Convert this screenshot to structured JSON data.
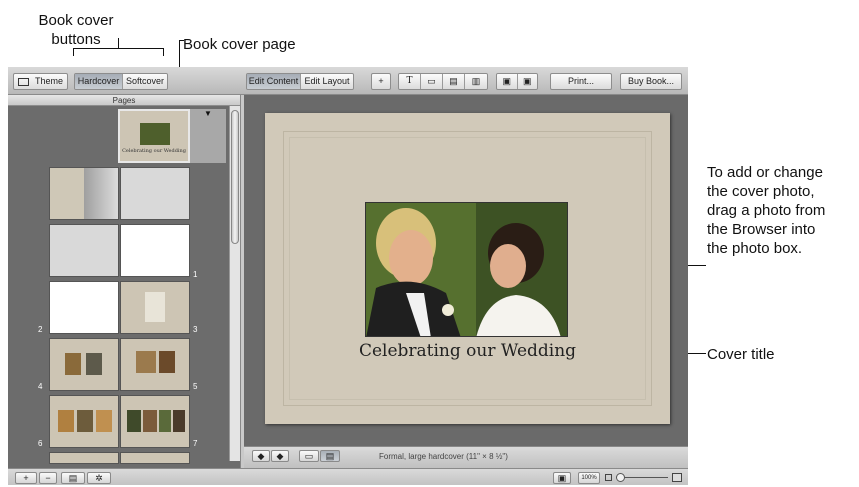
{
  "callouts": {
    "book_cover_buttons": [
      "Book cover",
      "buttons"
    ],
    "book_cover_page": "Book cover page",
    "cover_photo": [
      "To add or change",
      "the cover photo,",
      "drag a photo from",
      "the Browser into",
      "the photo box."
    ],
    "cover_title": "Cover title"
  },
  "toolbar": {
    "theme": "Theme",
    "hardcover": "Hardcover",
    "softcover": "Softcover",
    "edit_content": "Edit Content",
    "edit_layout": "Edit Layout",
    "add": "+",
    "print": "Print...",
    "buy_book": "Buy Book..."
  },
  "pages": {
    "header": "Pages",
    "cover_caption": "Celebrating our Wedding",
    "page_numbers": [
      "1",
      "2",
      "3",
      "4",
      "5",
      "6",
      "7"
    ]
  },
  "cover": {
    "title": "Celebrating our Wedding"
  },
  "editor": {
    "status": "Formal, large hardcover (11\" × 8 ½\")",
    "zoom": "100%"
  },
  "bottom": {
    "add": "+",
    "remove": "−"
  }
}
